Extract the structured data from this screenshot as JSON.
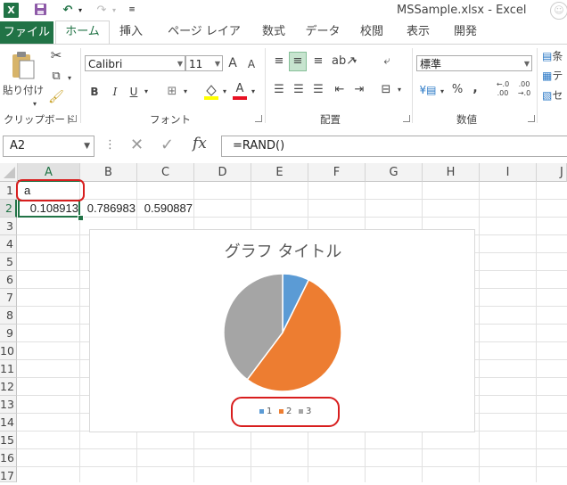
{
  "titlebar": {
    "logo": "X",
    "window_title": "MSSample.xlsx - Excel"
  },
  "icons": {
    "excel": "excel-logo-icon",
    "save": "save-icon",
    "undo": "undo-icon",
    "redo": "redo-icon",
    "paste": "clipboard-paste-icon",
    "cut": "scissors-icon",
    "copy": "copy-icon",
    "format_painter": "paintbrush-icon",
    "cancel": "x-icon",
    "enter": "checkmark-icon"
  },
  "tabs": [
    "ファイル",
    "ホーム",
    "挿入",
    "ページ レイアウト",
    "数式",
    "データ",
    "校閲",
    "表示",
    "開発"
  ],
  "ribbon": {
    "clipboard": {
      "paste_label": "貼り付け",
      "group_label": "クリップボード"
    },
    "font": {
      "name": "Calibri",
      "size": "11",
      "grow": "A",
      "shrink": "A",
      "bold": "B",
      "italic": "I",
      "underline": "U",
      "font_color_letter": "A",
      "group_label": "フォント"
    },
    "alignment": {
      "group_label": "配置"
    },
    "number": {
      "format": "標準",
      "percent": "%",
      "comma": ",",
      "increase_decimal": "←.0 .00",
      "decrease_decimal": ".00 →.0",
      "group_label": "数値"
    },
    "styles_partial": [
      "条",
      "テ",
      "セ"
    ]
  },
  "formula_bar": {
    "name_box": "A2",
    "fx": "fx",
    "formula": "=RAND()"
  },
  "sheet": {
    "columns": [
      "A",
      "B",
      "C",
      "D",
      "E",
      "F",
      "G",
      "H",
      "I",
      "J"
    ],
    "rows": [
      "1",
      "2",
      "3",
      "4",
      "5",
      "6",
      "7",
      "8",
      "9",
      "10",
      "11",
      "12",
      "13",
      "14",
      "15",
      "16",
      "17"
    ],
    "selected_cell": "A2",
    "cells": {
      "A1": "a",
      "A2": "0.108913",
      "B2": "0.786983",
      "C2": "0.590887"
    }
  },
  "chart": {
    "title": "グラフ タイトル",
    "legend": [
      "1",
      "2",
      "3"
    ]
  },
  "chart_data": {
    "type": "pie",
    "title": "グラフ タイトル",
    "categories": [
      "1",
      "2",
      "3"
    ],
    "values": [
      0.108913,
      0.786983,
      0.590887
    ],
    "colors": [
      "#5b9bd5",
      "#ed7d31",
      "#a5a5a5"
    ],
    "legend_position": "bottom"
  },
  "colors": {
    "excel_green": "#217346",
    "annotation_red": "#d81e1e"
  }
}
